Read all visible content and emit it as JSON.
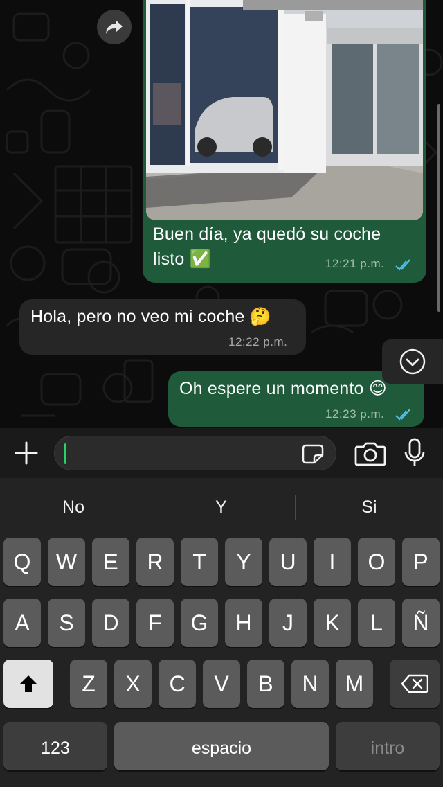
{
  "chat": {
    "messages": [
      {
        "direction": "outgoing",
        "type": "image",
        "caption": "Buen día, ya quedó su coche listo ✅",
        "caption_line1": "Buen día, ya quedó su coche",
        "caption_line2": "listo ✅",
        "time": "12:21 p.m."
      },
      {
        "direction": "incoming",
        "text": "Hola, pero no veo mi coche 🤔",
        "time": "12:22 p.m."
      },
      {
        "direction": "outgoing",
        "text": "Oh espere un momento 😊",
        "time": "12:23 p.m."
      }
    ]
  },
  "input": {
    "value": "",
    "placeholder": ""
  },
  "keyboard": {
    "suggestions": [
      "No",
      "Y",
      "Si"
    ],
    "rows": [
      [
        "Q",
        "W",
        "E",
        "R",
        "T",
        "Y",
        "U",
        "I",
        "O",
        "P"
      ],
      [
        "A",
        "S",
        "D",
        "F",
        "G",
        "H",
        "J",
        "K",
        "L",
        "Ñ"
      ],
      [
        "Z",
        "X",
        "C",
        "V",
        "B",
        "N",
        "M"
      ]
    ],
    "numbers_key": "123",
    "space_key": "espacio",
    "return_key": "intro"
  },
  "colors": {
    "outgoing_bubble": "#1f5b3a",
    "incoming_bubble": "#262626",
    "read_ticks": "#53bdeb",
    "caret": "#25d366"
  },
  "icons": [
    "forward-icon",
    "double-check-icon",
    "chevron-down-icon",
    "plus-icon",
    "sticker-icon",
    "camera-icon",
    "microphone-icon",
    "shift-icon",
    "backspace-icon"
  ]
}
